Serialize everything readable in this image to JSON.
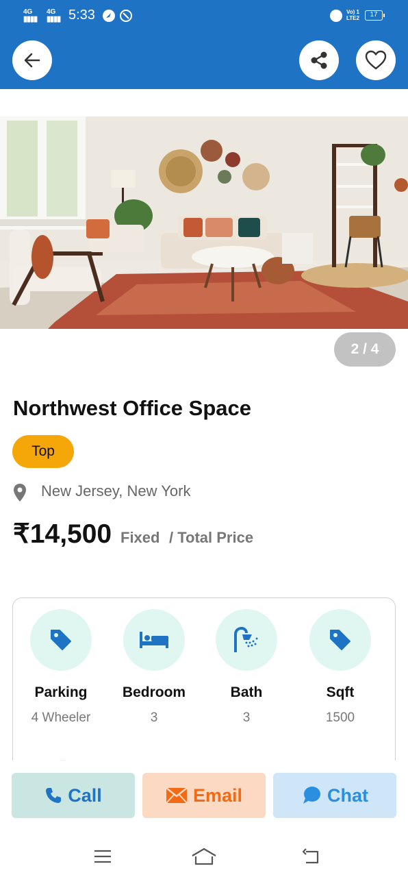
{
  "status_bar": {
    "signal_1": "4G",
    "signal_2": "4G",
    "time": "5:33",
    "volte_line1": "Vo) 1",
    "volte_line2": "LTE2",
    "battery": "17"
  },
  "header": {
    "back_icon": "arrow-left-icon",
    "share_icon": "share-icon",
    "favorite_icon": "heart-outline-icon"
  },
  "gallery": {
    "counter": "2 / 4",
    "current": 2,
    "total": 4
  },
  "property": {
    "title": "Northwest Office Space",
    "badge": "Top",
    "location": "New Jersey, New York",
    "price": "₹14,500",
    "price_type": "Fixed",
    "price_label": "/ Total Price"
  },
  "features": [
    {
      "name": "Parking",
      "value": "4 Wheeler",
      "icon": "tag-icon"
    },
    {
      "name": "Bedroom",
      "value": "3",
      "icon": "bed-icon"
    },
    {
      "name": "Bath",
      "value": "3",
      "icon": "shower-icon"
    },
    {
      "name": "Sqft",
      "value": "1500",
      "icon": "tag-icon"
    }
  ],
  "actions": {
    "call": "Call",
    "email": "Email",
    "chat": "Chat"
  },
  "colors": {
    "primary": "#1f73c4",
    "badge": "#f5a609",
    "feature_bubble": "#e0f7f1",
    "call_bg": "#c9e6e2",
    "email_bg": "#fcd9c3",
    "email_fg": "#f26a13",
    "chat_bg": "#cfe6f8"
  }
}
